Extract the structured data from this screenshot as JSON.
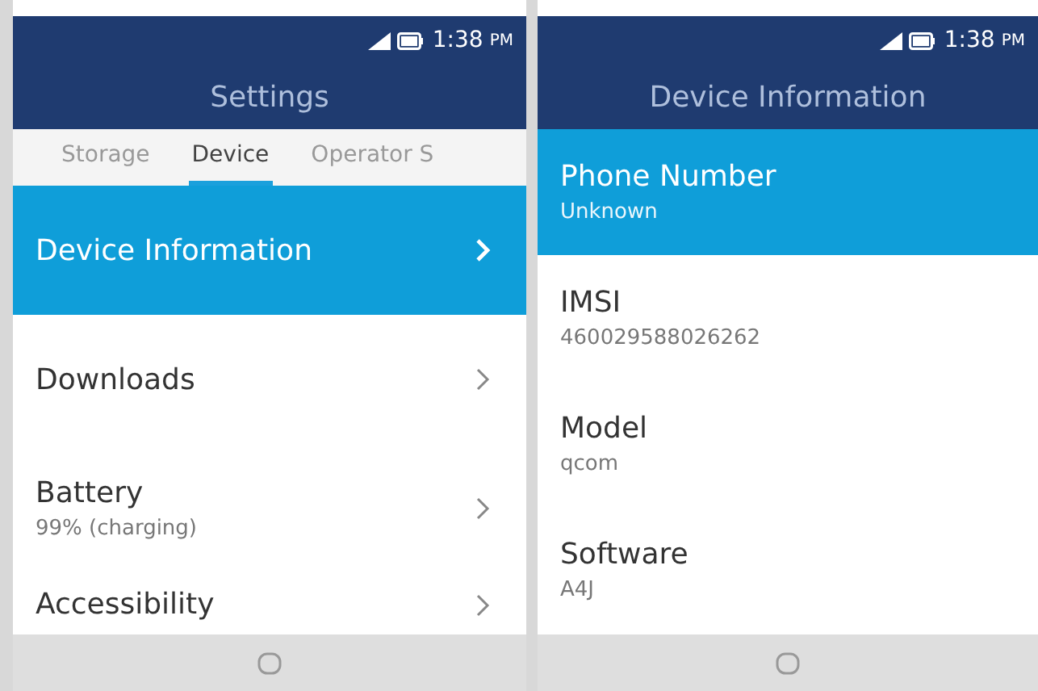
{
  "screens": [
    {
      "status_bar": {
        "time": "1:38",
        "ampm": "PM"
      },
      "title": "Settings",
      "tabs": [
        {
          "label": "Storage",
          "selected": false
        },
        {
          "label": "Device",
          "selected": true
        },
        {
          "label": "Operator S",
          "selected": false
        }
      ],
      "items": [
        {
          "kind": "link",
          "title": "Device Information",
          "selected": true
        },
        {
          "kind": "link",
          "title": "Downloads",
          "selected": false
        },
        {
          "kind": "link",
          "title": "Battery",
          "subtitle": "99% (charging)",
          "selected": false
        },
        {
          "kind": "link",
          "title": "Accessibility",
          "selected": false
        }
      ]
    },
    {
      "status_bar": {
        "time": "1:38",
        "ampm": "PM"
      },
      "title": "Device Information",
      "items": [
        {
          "kind": "info",
          "title": "Phone Number",
          "subtitle": "Unknown",
          "selected": true
        },
        {
          "kind": "info",
          "title": "IMSI",
          "subtitle": "460029588026262",
          "selected": false
        },
        {
          "kind": "info",
          "title": "Model",
          "subtitle": "qcom",
          "selected": false
        },
        {
          "kind": "info",
          "title": "Software",
          "subtitle": "A4J",
          "selected": false
        }
      ]
    }
  ]
}
